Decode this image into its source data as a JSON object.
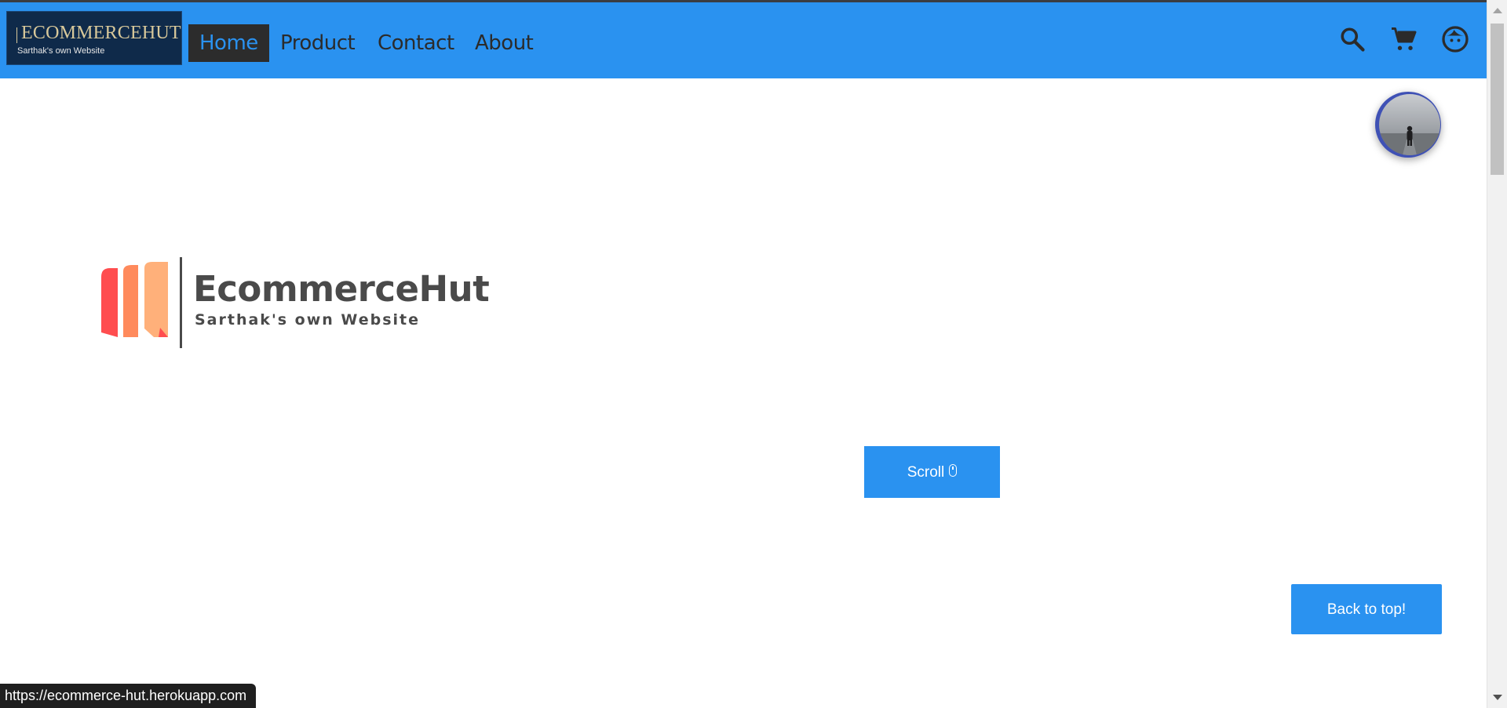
{
  "navbar": {
    "logo": {
      "title": "ECOMMERCEHUT",
      "subtitle": "Sarthak's own Website"
    },
    "links": [
      {
        "label": "Home",
        "active": true
      },
      {
        "label": "Product",
        "active": false
      },
      {
        "label": "Contact",
        "active": false
      },
      {
        "label": "About",
        "active": false
      }
    ],
    "icons": [
      "search-icon",
      "cart-icon",
      "face-icon"
    ],
    "background_color": "#2a92f0",
    "active_link_bg": "#2c2c2c"
  },
  "hero": {
    "title": "EcommerceHut",
    "subtitle": "Sarthak's own Website",
    "logo_colors": [
      "#ff4d4f",
      "#ff8a5c",
      "#ffb07a"
    ]
  },
  "scroll_button": {
    "label": "Scroll",
    "icon": "mouse-icon"
  },
  "back_to_top": {
    "label": "Back to top!"
  },
  "avatar": {
    "icon": "user-avatar"
  },
  "status_bar": {
    "url": "https://ecommerce-hut.herokuapp.com"
  },
  "colors": {
    "accent": "#2a92f0",
    "text_dark": "#2b2b2b",
    "avatar_ring": "#3f51b5"
  }
}
